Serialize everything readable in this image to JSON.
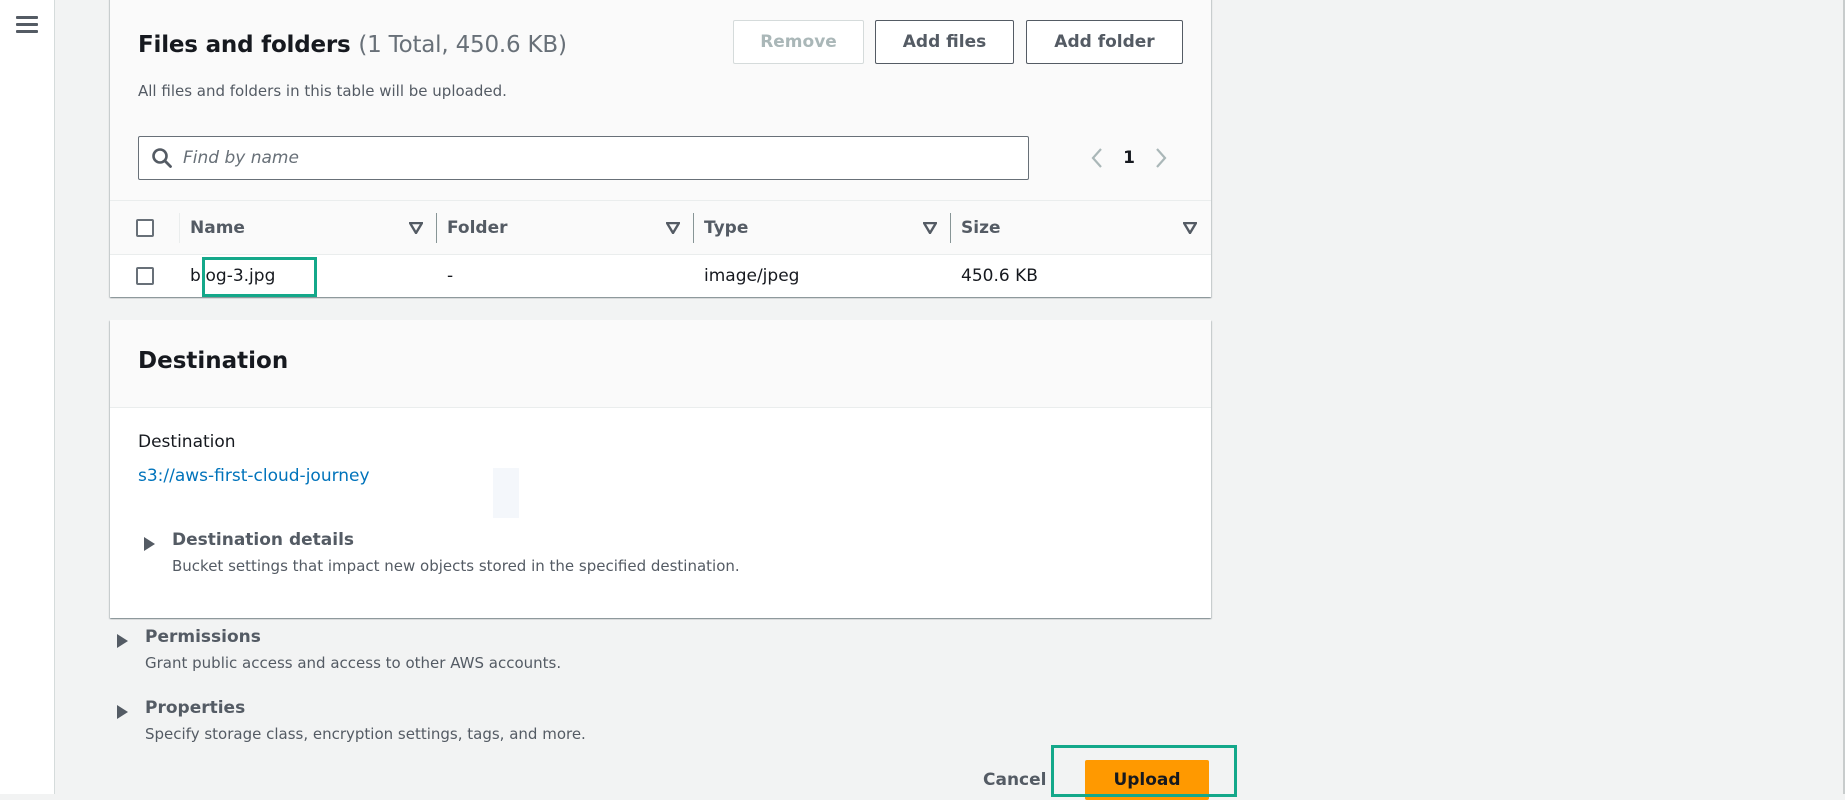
{
  "sidebar": {
    "menu_icon": "hamburger-menu-icon"
  },
  "files_panel": {
    "title": "Files and folders",
    "counter": "(1 Total, 450.6 KB)",
    "description": "All files and folders in this table will be uploaded.",
    "buttons": {
      "remove": "Remove",
      "add_files": "Add files",
      "add_folder": "Add folder"
    },
    "search": {
      "placeholder": "Find by name",
      "value": ""
    },
    "pagination": {
      "current_page": "1"
    },
    "columns": [
      "Name",
      "Folder",
      "Type",
      "Size"
    ],
    "rows": [
      {
        "name": "blog-3.jpg",
        "folder": "-",
        "type": "image/jpeg",
        "size": "450.6 KB",
        "selected": false
      }
    ]
  },
  "destination_panel": {
    "title": "Destination",
    "label": "Destination",
    "bucket_uri": "s3://aws-first-cloud-journey",
    "details": {
      "title": "Destination details",
      "description": "Bucket settings that impact new objects stored in the specified destination."
    }
  },
  "permissions": {
    "title": "Permissions",
    "description": "Grant public access and access to other AWS accounts."
  },
  "properties": {
    "title": "Properties",
    "description": "Specify storage class, encryption settings, tags, and more."
  },
  "actions": {
    "cancel": "Cancel",
    "upload": "Upload"
  },
  "colors": {
    "primary_action": "#ff9900",
    "link": "#0073bb",
    "highlight": "#14a88a"
  }
}
